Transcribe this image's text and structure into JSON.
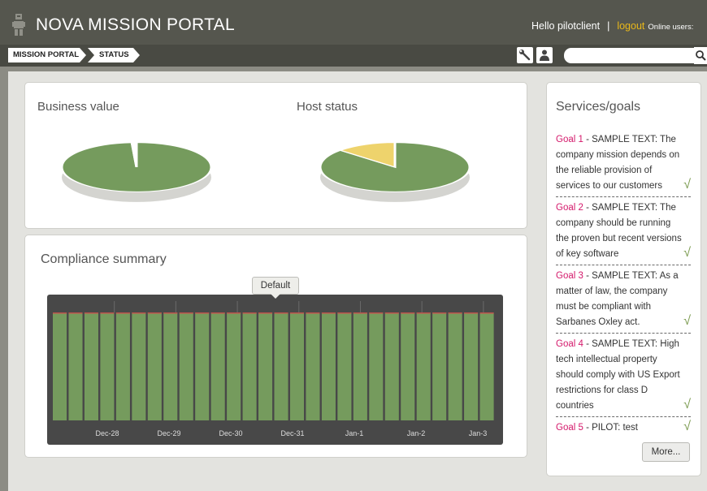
{
  "header": {
    "app_title": "NOVA MISSION PORTAL",
    "greeting": "Hello pilotclient",
    "separator": "|",
    "logout_label": "logout",
    "online_label": "Online users:",
    "logo_icon": "robot-icon",
    "accent_color": "#e8b71a"
  },
  "breadcrumb": {
    "items": [
      {
        "label": "MISSION PORTAL"
      },
      {
        "label": "STATUS"
      }
    ]
  },
  "toolbar": {
    "tools_icon": "wrench-icon",
    "user_icon": "user-icon",
    "search_icon": "search-icon",
    "search_value": "",
    "search_placeholder": ""
  },
  "business_panel": {
    "title": "Business value",
    "pie": {
      "type": "pie",
      "slices": [
        {
          "label": "",
          "value": 99,
          "color": "#759b5d"
        },
        {
          "label": "",
          "value": 1,
          "color": "#ffffff"
        }
      ]
    }
  },
  "host_panel": {
    "title": "Host status",
    "pie": {
      "type": "pie",
      "slices": [
        {
          "label": "",
          "value": 87,
          "color": "#759b5d"
        },
        {
          "label": "",
          "value": 13,
          "color": "#eed36c"
        }
      ]
    }
  },
  "compliance": {
    "title": "Compliance summary",
    "tooltip": "Default"
  },
  "chart_data": {
    "type": "bar",
    "x_tick_labels": [
      "Dec-28",
      "Dec-29",
      "Dec-30",
      "Dec-31",
      "Jan-1",
      "Jan-2",
      "Jan-3"
    ],
    "bar_count": 28,
    "values": [
      100,
      100,
      100,
      100,
      100,
      100,
      100,
      100,
      100,
      100,
      100,
      100,
      100,
      100,
      100,
      100,
      100,
      100,
      100,
      100,
      100,
      100,
      100,
      100,
      100,
      100,
      100,
      100
    ],
    "ylim": [
      0,
      100
    ],
    "bar_color": "#759b5d",
    "top_color": "#c0504d",
    "background": "#484848",
    "grid": true
  },
  "services": {
    "title": "Services/goals",
    "goals": [
      {
        "name": "Goal 1",
        "text": " - SAMPLE TEXT: The company mission depends on the reliable provision of services to our customers",
        "check": "√"
      },
      {
        "name": "Goal 2",
        "text": " - SAMPLE TEXT: The company should be running the proven but recent versions of key software",
        "check": "√"
      },
      {
        "name": "Goal 3",
        "text": " - SAMPLE TEXT: As a matter of law, the company must be compliant with Sarbanes Oxley act.",
        "check": "√"
      },
      {
        "name": "Goal 4",
        "text": " - SAMPLE TEXT: High tech intellectual property should comply with US Export restrictions for class D countries",
        "check": "√"
      },
      {
        "name": "Goal 5",
        "text": " - PILOT: test",
        "check": "√"
      }
    ],
    "name_color": "#d4196b",
    "check_color": "#7a9a4e",
    "more_label": "More..."
  }
}
